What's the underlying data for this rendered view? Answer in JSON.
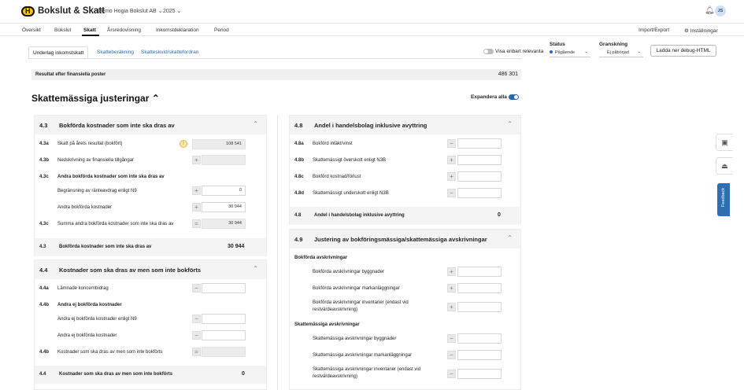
{
  "app": {
    "brand": "Bokslut & Skatt",
    "company": "Demo Hogia Bokslut AB ⌄",
    "year": "2025 ⌄",
    "user_initials": "JS"
  },
  "nav": {
    "items": [
      "Översikt",
      "Bokslut",
      "Skatt",
      "Årsredovisning",
      "Inkomstdeklaration",
      "Period"
    ],
    "active": "Skatt",
    "import_export": "Import/Export",
    "settings": "Inställningar"
  },
  "tabs": [
    "Underlag inkomstskatt",
    "Skatteberäkning",
    "Skatteskuld/skattefordran"
  ],
  "toolbar": {
    "relevant_label": "Visa enbart relevanta",
    "status_title": "Status",
    "status_value": "Pågående",
    "review_title": "Granskning",
    "review_value": "Ej påbörjad",
    "debug_button": "Ladda ner debug-HTML"
  },
  "result": {
    "label": "Resultat efter finansiella poster",
    "value": "486 301"
  },
  "section": {
    "title": "Skattemässiga justeringar ⌃",
    "expand_all": "Expandera alla"
  },
  "p43": {
    "num": "4.3",
    "title": "Bokförda kostnader som inte ska dras av",
    "r1_code": "4.3a",
    "r1_label": "Skatt på årets resultat (bokfört)",
    "r1_value": "108 541",
    "r2_code": "4.3b",
    "r2_label": "Nedskrivning av finansiella tillgångar",
    "r3_code": "4.3c",
    "r3_label": "Andra bokförda kostnader som inte ska dras av",
    "r4_label": "Begränsning av ränteavdrag enligt N9",
    "r4_value": "0",
    "r5_label": "Andra bokförda kostnader",
    "r5_value": "30 944",
    "r6_code": "4.3c",
    "r6_label": "Summa andra bokförda kostnader som inte ska dras av",
    "r6_value": "30 944",
    "total_code": "4.3",
    "total_label": "Bokförda kostnader som inte ska dras av",
    "total_value": "30 944"
  },
  "p44": {
    "num": "4.4",
    "title": "Kostnader som ska dras av men som inte bokförts",
    "r1_code": "4.4a",
    "r1_label": "Lämnade koncernbidrag",
    "r2_code": "4.4b",
    "r2_label": "Andra ej bokförda kostnader",
    "r3_label": "Andra ej bokförda kostnader enligt N9",
    "r4_label": "Andra ej bokförda kostnader",
    "r5_code": "4.4b",
    "r5_label": "Kostnader som ska dras av men som inte bokförts",
    "total_code": "4.4",
    "total_label": "Kostnader som ska dras av men som inte bokförts",
    "total_value": "0"
  },
  "p48": {
    "num": "4.8",
    "title": "Andel i handelsbolag inklusive avyttring",
    "r1_code": "4.8a",
    "r1_label": "Bokförd intäkt/vinst",
    "r2_code": "4.8b",
    "r2_label": "Skattemässigt överskott enligt N3B",
    "r3_code": "4.8c",
    "r3_label": "Bokförd kostnad/förlust",
    "r4_code": "4.8d",
    "r4_label": "Skattemässigt underskott enligt N3B",
    "total_code": "4.8",
    "total_label": "Andel i handelsbolag inklusive avyttring",
    "total_value": "0"
  },
  "p49": {
    "num": "4.9",
    "title": "Justering av bokföringsmässiga/skattemässiga avskrivningar",
    "sub1": "Bokförda avskrivningar",
    "r1_label": "Bokförda avskrivningar byggnader",
    "r2_label": "Bokförda avskrivningar markanläggningar",
    "r3_label_a": "Bokförda avskrivningar inventarier (endast vid",
    "r3_label_b": "restvärdeavskrivning)",
    "sub2": "Skattemässiga avskrivningar",
    "r4_label": "Skattemässiga avskrivningar byggnader",
    "r5_label": "Skattemässiga avskrivningar markanläggningar",
    "r6_label_a": "Skattemässiga avskrivningar inventarier (endast vid",
    "r6_label_b": "restvärdeavskrivning)"
  },
  "sidebar": {
    "feedback": "Feedback"
  },
  "icons": {
    "plus": "+",
    "minus": "−",
    "equals": "=",
    "chevron_up": "⌃",
    "warning": "!"
  }
}
